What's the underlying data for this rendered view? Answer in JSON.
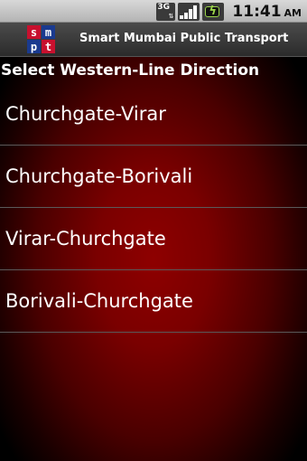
{
  "status_bar": {
    "network_label": "3G",
    "time": "11:41",
    "ampm": "AM",
    "icons": [
      "3g-data-icon",
      "signal-strength-icon",
      "battery-charging-icon"
    ],
    "signal_bars": 4
  },
  "app_bar": {
    "logo_letters": [
      "s",
      "m",
      "p",
      "t"
    ],
    "title": "Smart Mumbai Public Transport"
  },
  "main": {
    "heading": "Select Western-Line Direction",
    "directions": [
      "Churchgate-Virar",
      "Churchgate-Borivali",
      "Virar-Churchgate",
      "Borivali-Churchgate"
    ]
  },
  "colors": {
    "background_center": "#8e0000",
    "background_edge": "#000000",
    "divider": "#5a5a5a",
    "text": "#ffffff",
    "logo_red": "#c8102e",
    "logo_blue": "#1a3a8f"
  }
}
